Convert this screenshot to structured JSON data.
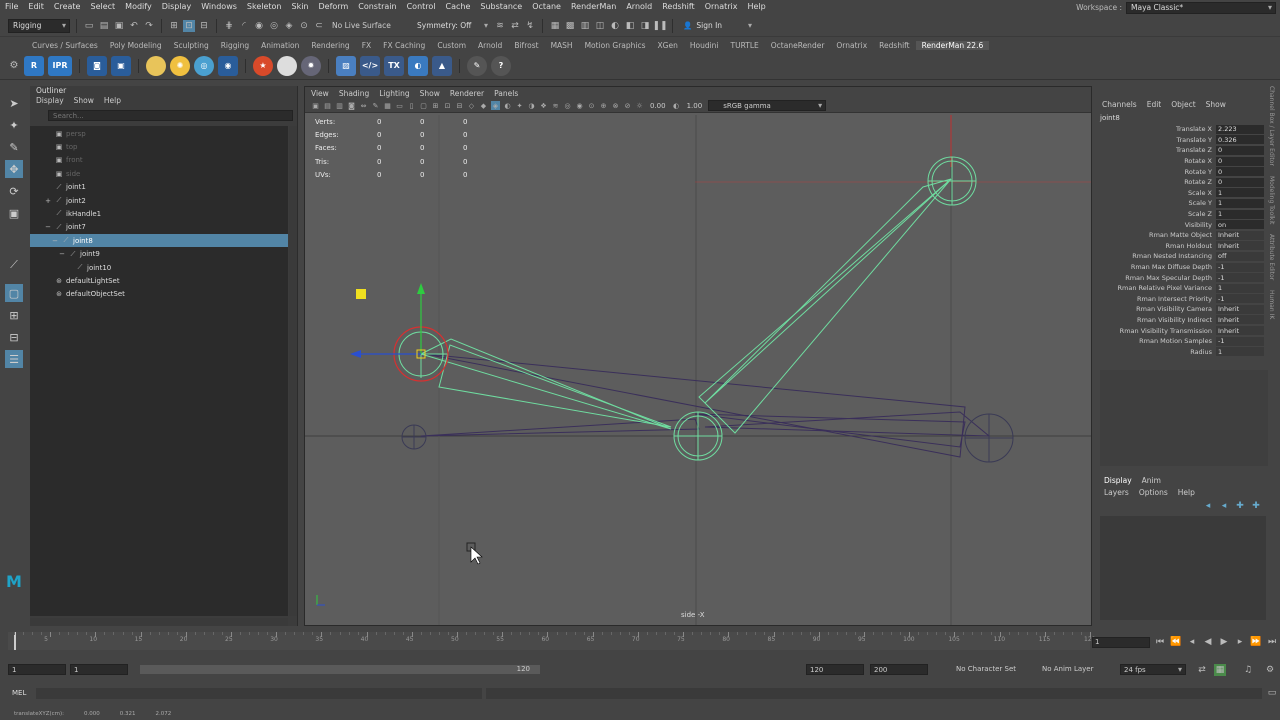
{
  "menubar": {
    "items": [
      "File",
      "Edit",
      "Create",
      "Select",
      "Modify",
      "Display",
      "Windows",
      "Skeleton",
      "Skin",
      "Deform",
      "Constrain",
      "Control",
      "Cache",
      "Substance",
      "Octane",
      "RenderMan",
      "Arnold",
      "Redshift",
      "Ornatrix",
      "Help"
    ],
    "workspace_label": "Workspace :",
    "workspace_value": "Maya Classic*"
  },
  "statusline": {
    "mode": "Rigging",
    "live_surface": "No Live Surface",
    "symmetry": "Symmetry: Off",
    "sign_in": "Sign In"
  },
  "shelf": {
    "tabs": [
      "Curves / Surfaces",
      "Poly Modeling",
      "Sculpting",
      "Rigging",
      "Animation",
      "Rendering",
      "FX",
      "FX Caching",
      "Custom",
      "Arnold",
      "Bifrost",
      "MASH",
      "Motion Graphics",
      "XGen",
      "Houdini",
      "TURTLE",
      "OctaneRender",
      "Ornatrix",
      "Redshift",
      "RenderMan 22.6"
    ],
    "active_tab": "RenderMan 22.6",
    "icons": [
      {
        "label": "R",
        "color": "#2f78c4"
      },
      {
        "label": "IPR",
        "color": "#2f78c4"
      },
      {
        "label": "",
        "color": "#2a5d9a"
      },
      {
        "label": "",
        "color": "#2a5d9a"
      }
    ]
  },
  "outliner": {
    "title": "Outliner",
    "menu": [
      "Display",
      "Show",
      "Help"
    ],
    "search_placeholder": "Search...",
    "rows": [
      {
        "label": "persp",
        "indent": 0,
        "dim": true,
        "icon": "camera-icon"
      },
      {
        "label": "top",
        "indent": 0,
        "dim": true,
        "icon": "camera-icon"
      },
      {
        "label": "front",
        "indent": 0,
        "dim": true,
        "icon": "camera-icon"
      },
      {
        "label": "side",
        "indent": 0,
        "dim": true,
        "icon": "camera-icon"
      },
      {
        "label": "joint1",
        "indent": 0,
        "dim": false,
        "icon": "joint-icon"
      },
      {
        "label": "joint2",
        "indent": 0,
        "dim": false,
        "icon": "joint-icon",
        "expand": "+"
      },
      {
        "label": "ikHandle1",
        "indent": 0,
        "dim": false,
        "icon": "ik-handle-icon"
      },
      {
        "label": "joint7",
        "indent": 0,
        "dim": false,
        "icon": "joint-icon",
        "expand": "−"
      },
      {
        "label": "joint8",
        "indent": 1,
        "dim": false,
        "icon": "joint-icon",
        "selected": true,
        "expand": "−"
      },
      {
        "label": "joint9",
        "indent": 2,
        "dim": false,
        "icon": "joint-icon",
        "expand": "−"
      },
      {
        "label": "joint10",
        "indent": 3,
        "dim": false,
        "icon": "joint-icon"
      },
      {
        "label": "defaultLightSet",
        "indent": 0,
        "dim": false,
        "icon": "set-icon"
      },
      {
        "label": "defaultObjectSet",
        "indent": 0,
        "dim": false,
        "icon": "set-icon"
      }
    ]
  },
  "viewport": {
    "menu": [
      "View",
      "Shading",
      "Lighting",
      "Show",
      "Renderer",
      "Panels"
    ],
    "exposure": "0.00",
    "gamma": "1.00",
    "color_space": "sRGB gamma",
    "hud": [
      {
        "label": "Verts:",
        "values": [
          "0",
          "0",
          "0"
        ]
      },
      {
        "label": "Edges:",
        "values": [
          "0",
          "0",
          "0"
        ]
      },
      {
        "label": "Faces:",
        "values": [
          "0",
          "0",
          "0"
        ]
      },
      {
        "label": "Tris:",
        "values": [
          "0",
          "0",
          "0"
        ]
      },
      {
        "label": "UVs:",
        "values": [
          "0",
          "0",
          "0"
        ]
      }
    ],
    "camera_label": "side -X"
  },
  "channelbox": {
    "menu": [
      "Channels",
      "Edit",
      "Object",
      "Show"
    ],
    "node": "joint8",
    "channels": [
      {
        "name": "Translate X",
        "value": "2.223"
      },
      {
        "name": "Translate Y",
        "value": "0.326"
      },
      {
        "name": "Translate Z",
        "value": "0"
      },
      {
        "name": "Rotate X",
        "value": "0"
      },
      {
        "name": "Rotate Y",
        "value": "0"
      },
      {
        "name": "Rotate Z",
        "value": "0"
      },
      {
        "name": "Scale X",
        "value": "1"
      },
      {
        "name": "Scale Y",
        "value": "1"
      },
      {
        "name": "Scale Z",
        "value": "1"
      },
      {
        "name": "Visibility",
        "value": "on"
      },
      {
        "name": "Rman Matte Object",
        "value": "Inherit"
      },
      {
        "name": "Rman Holdout",
        "value": "Inherit"
      },
      {
        "name": "Rman Nested Instancing",
        "value": "off"
      },
      {
        "name": "Rman Max Diffuse Depth",
        "value": "-1"
      },
      {
        "name": "Rman Max Specular Depth",
        "value": "-1"
      },
      {
        "name": "Rman Relative Pixel Variance",
        "value": "1"
      },
      {
        "name": "Rman Intersect Priority",
        "value": "-1"
      },
      {
        "name": "Rman Visibility Camera",
        "value": "Inherit"
      },
      {
        "name": "Rman Visibility Indirect",
        "value": "Inherit"
      },
      {
        "name": "Rman Visibility Transmission",
        "value": "Inherit"
      },
      {
        "name": "Rman Motion Samples",
        "value": "-1"
      },
      {
        "name": "Radius",
        "value": "1"
      }
    ],
    "layer_tabs": [
      "Display",
      "Anim"
    ],
    "layer_menu": [
      "Layers",
      "Options",
      "Help"
    ]
  },
  "sidestrip": [
    "Channel Box / Layer Editor",
    "Modeling Toolkit",
    "Attribute Editor",
    "Human IK"
  ],
  "timeslider": {
    "ticks": [
      "5",
      "10",
      "15",
      "20",
      "25",
      "30",
      "35",
      "40",
      "45",
      "50",
      "55",
      "60",
      "65",
      "70",
      "75",
      "80",
      "85",
      "90",
      "95",
      "100",
      "105",
      "110",
      "115",
      "120"
    ],
    "current_frame": "1"
  },
  "rangeslider": {
    "start": "1",
    "range_start": "1",
    "range_end_label": "120",
    "end": "120",
    "anim_end": "200",
    "character_set": "No Character Set",
    "anim_layer": "No Anim Layer",
    "fps": "24 fps"
  },
  "cmdline": {
    "label": "MEL"
  },
  "helpline": {
    "items": [
      "translateXYZ(cm):",
      "0.000",
      "0.321",
      "2.072"
    ]
  },
  "colors": {
    "selection": "#5285a6",
    "viewport_bg": "#5d5d5d",
    "bone": "#6fdca0",
    "bone_dark": "#3a2f5a",
    "x_axis": "#d83030",
    "y_axis": "#2ecc40",
    "z_axis": "#2a4fd0"
  }
}
